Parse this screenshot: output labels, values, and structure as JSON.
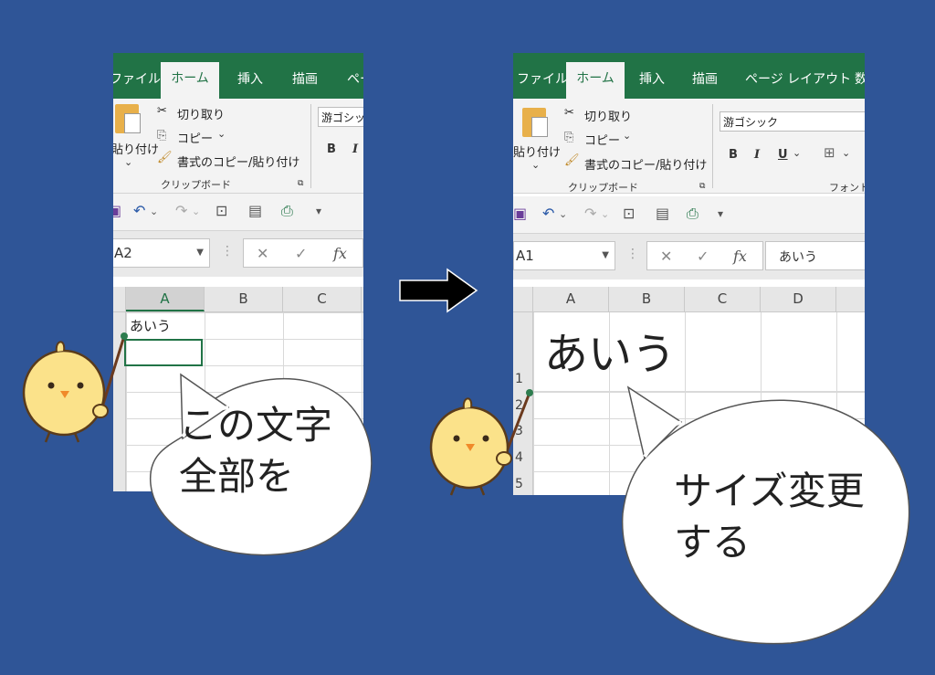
{
  "ribbon": {
    "tabs_left": [
      "ファイル",
      "ホーム",
      "挿入",
      "描画",
      "ペー"
    ],
    "tabs_right": [
      "ファイル",
      "ホーム",
      "挿入",
      "描画",
      "ページ レイアウト",
      "数"
    ],
    "cut_label": "切り取り",
    "copy_label": "コピー",
    "format_painter_label": "書式のコピー/貼り付け",
    "paste_label": "貼り付け",
    "clipboard_group": "クリップボード",
    "font_group": "フォント",
    "font_name_left": "游ゴシック",
    "font_name_right": "游ゴシック",
    "bold": "B",
    "italic": "I",
    "underline": "U"
  },
  "left": {
    "name_box": "A2",
    "columns": [
      "A",
      "B",
      "C"
    ],
    "cell_a1": "あいう"
  },
  "right": {
    "name_box": "A1",
    "formula_content": "あいう",
    "columns": [
      "A",
      "B",
      "C",
      "D"
    ],
    "rows": [
      "1",
      "2",
      "3",
      "4",
      "5"
    ],
    "cell_a1": "あいう"
  },
  "formula": {
    "fx": "fx",
    "cancel": "✕",
    "enter": "✓"
  },
  "bubbles": {
    "left": "この文字\n全部を",
    "right": "サイズ変更\nする"
  },
  "colors": {
    "background": "#2f5597",
    "excel_green": "#217346",
    "chick": "#fbe28a"
  }
}
